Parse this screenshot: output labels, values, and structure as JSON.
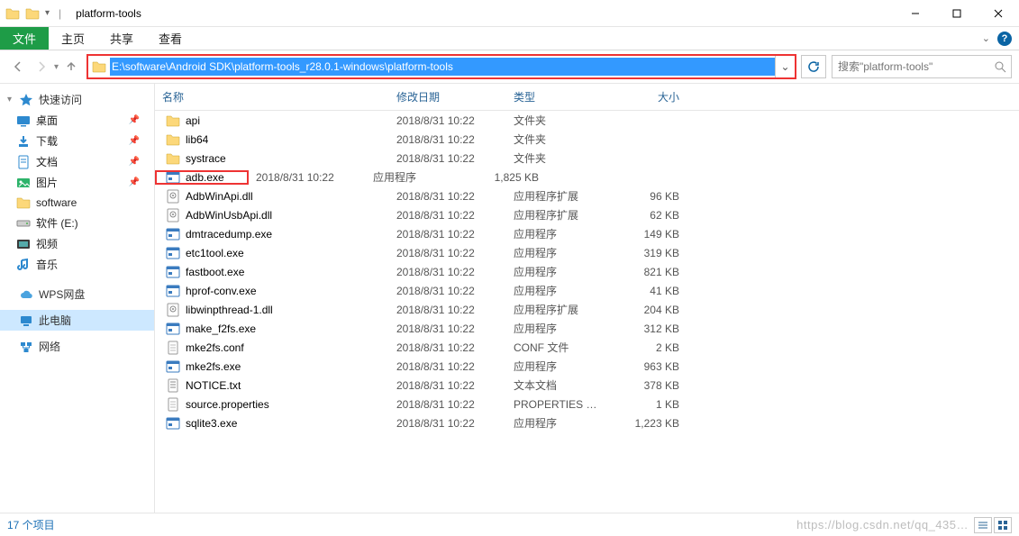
{
  "window": {
    "title": "platform-tools"
  },
  "ribbon": {
    "file": "文件",
    "tabs": [
      "主页",
      "共享",
      "查看"
    ]
  },
  "nav": {
    "address": "E:\\software\\Android SDK\\platform-tools_r28.0.1-windows\\platform-tools",
    "search_placeholder": "搜索\"platform-tools\""
  },
  "sidebar": {
    "quick_access": "快速访问",
    "items": [
      {
        "label": "桌面",
        "pinned": true,
        "icon": "desktop"
      },
      {
        "label": "下载",
        "pinned": true,
        "icon": "downloads"
      },
      {
        "label": "文档",
        "pinned": true,
        "icon": "documents"
      },
      {
        "label": "图片",
        "pinned": true,
        "icon": "pictures"
      },
      {
        "label": "software",
        "pinned": false,
        "icon": "folder"
      },
      {
        "label": "软件 (E:)",
        "pinned": false,
        "icon": "drive"
      },
      {
        "label": "视频",
        "pinned": false,
        "icon": "videos"
      },
      {
        "label": "音乐",
        "pinned": false,
        "icon": "music"
      }
    ],
    "wps": "WPS网盘",
    "this_pc": "此电脑",
    "network": "网络"
  },
  "columns": {
    "name": "名称",
    "date": "修改日期",
    "type": "类型",
    "size": "大小"
  },
  "files": [
    {
      "name": "api",
      "date": "2018/8/31 10:22",
      "type": "文件夹",
      "size": "",
      "icon": "folder"
    },
    {
      "name": "lib64",
      "date": "2018/8/31 10:22",
      "type": "文件夹",
      "size": "",
      "icon": "folder"
    },
    {
      "name": "systrace",
      "date": "2018/8/31 10:22",
      "type": "文件夹",
      "size": "",
      "icon": "folder"
    },
    {
      "name": "adb.exe",
      "date": "2018/8/31 10:22",
      "type": "应用程序",
      "size": "1,825 KB",
      "icon": "exe",
      "hl": true
    },
    {
      "name": "AdbWinApi.dll",
      "date": "2018/8/31 10:22",
      "type": "应用程序扩展",
      "size": "96 KB",
      "icon": "dll"
    },
    {
      "name": "AdbWinUsbApi.dll",
      "date": "2018/8/31 10:22",
      "type": "应用程序扩展",
      "size": "62 KB",
      "icon": "dll"
    },
    {
      "name": "dmtracedump.exe",
      "date": "2018/8/31 10:22",
      "type": "应用程序",
      "size": "149 KB",
      "icon": "exe"
    },
    {
      "name": "etc1tool.exe",
      "date": "2018/8/31 10:22",
      "type": "应用程序",
      "size": "319 KB",
      "icon": "exe"
    },
    {
      "name": "fastboot.exe",
      "date": "2018/8/31 10:22",
      "type": "应用程序",
      "size": "821 KB",
      "icon": "exe"
    },
    {
      "name": "hprof-conv.exe",
      "date": "2018/8/31 10:22",
      "type": "应用程序",
      "size": "41 KB",
      "icon": "exe"
    },
    {
      "name": "libwinpthread-1.dll",
      "date": "2018/8/31 10:22",
      "type": "应用程序扩展",
      "size": "204 KB",
      "icon": "dll"
    },
    {
      "name": "make_f2fs.exe",
      "date": "2018/8/31 10:22",
      "type": "应用程序",
      "size": "312 KB",
      "icon": "exe"
    },
    {
      "name": "mke2fs.conf",
      "date": "2018/8/31 10:22",
      "type": "CONF 文件",
      "size": "2 KB",
      "icon": "file"
    },
    {
      "name": "mke2fs.exe",
      "date": "2018/8/31 10:22",
      "type": "应用程序",
      "size": "963 KB",
      "icon": "exe"
    },
    {
      "name": "NOTICE.txt",
      "date": "2018/8/31 10:22",
      "type": "文本文档",
      "size": "378 KB",
      "icon": "txt"
    },
    {
      "name": "source.properties",
      "date": "2018/8/31 10:22",
      "type": "PROPERTIES 文件",
      "size": "1 KB",
      "icon": "file"
    },
    {
      "name": "sqlite3.exe",
      "date": "2018/8/31 10:22",
      "type": "应用程序",
      "size": "1,223 KB",
      "icon": "exe"
    }
  ],
  "status": {
    "items": "17 个项目",
    "watermark": "https://blog.csdn.net/qq_435…"
  }
}
